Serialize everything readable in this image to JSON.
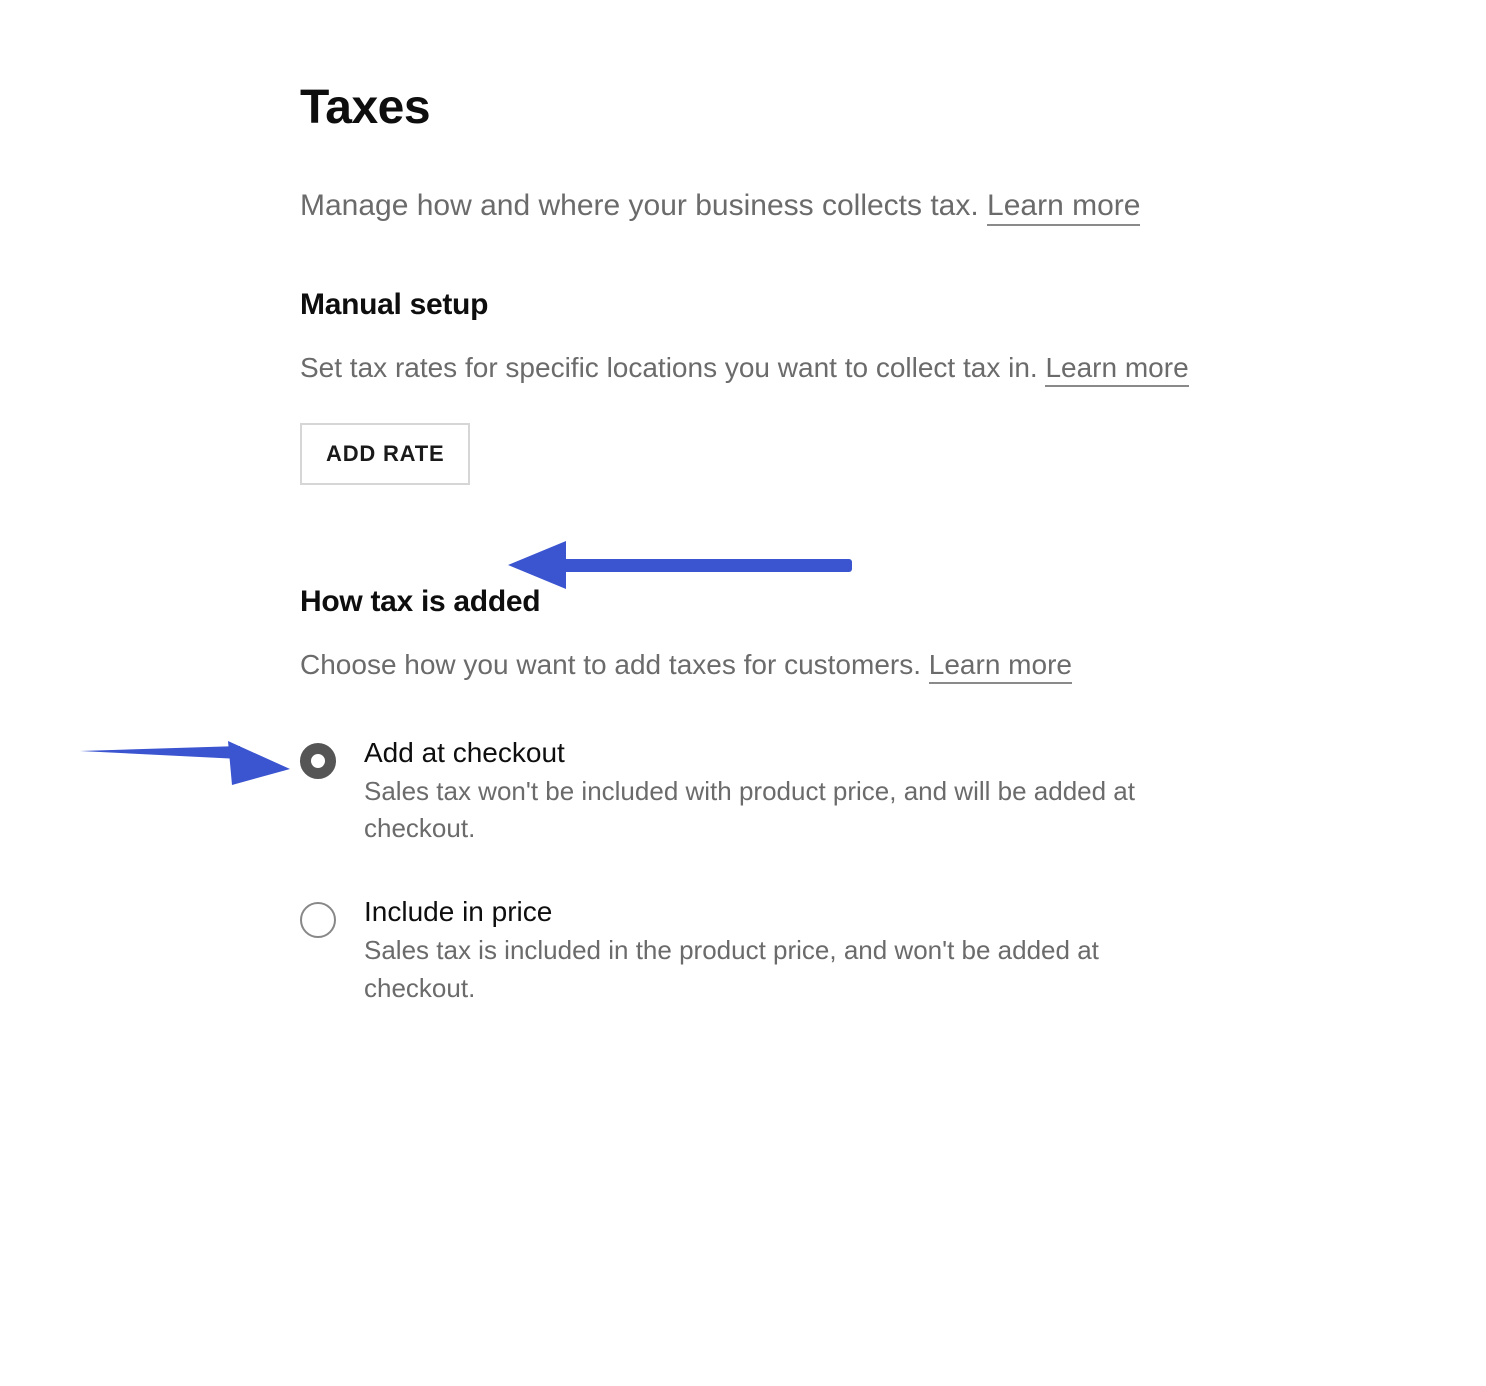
{
  "page": {
    "title": "Taxes",
    "subtitle_text": "Manage how and where your business collects tax. ",
    "subtitle_link": "Learn more",
    "arrow_color": "#3B54D0"
  },
  "manual_setup": {
    "heading": "Manual setup",
    "desc_text": "Set tax rates for specific locations you want to collect tax in. ",
    "desc_link": "Learn more",
    "button_label": "ADD RATE"
  },
  "how_tax_added": {
    "heading": "How tax is added",
    "desc_text": "Choose how you want to add taxes for customers. ",
    "desc_link": "Learn more",
    "options": [
      {
        "label": "Add at checkout",
        "desc": "Sales tax won't be included with product price, and will be added at checkout.",
        "selected": true
      },
      {
        "label": "Include in price",
        "desc": "Sales tax is included in the product price, and won't be added at checkout.",
        "selected": false
      }
    ]
  }
}
